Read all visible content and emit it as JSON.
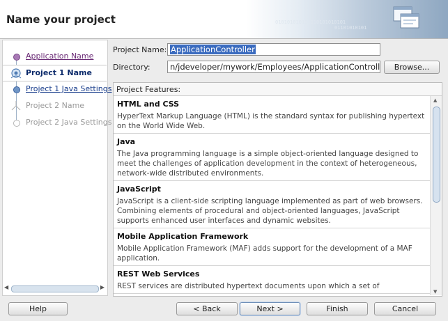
{
  "header": {
    "title": "Name your project"
  },
  "nav": {
    "items": [
      {
        "label": "Application Name",
        "state": "visited"
      },
      {
        "label": "Project 1 Name",
        "state": "active"
      },
      {
        "label": "Project 1 Java Settings",
        "state": "link"
      },
      {
        "label": "Project 2 Name",
        "state": "disabled"
      },
      {
        "label": "Project 2 Java Settings",
        "state": "disabled"
      }
    ]
  },
  "form": {
    "project_name_label": "Project Name:",
    "project_name_value": "ApplicationController",
    "directory_label": "Directory:",
    "directory_value": "n/jdeveloper/mywork/Employees/ApplicationController",
    "browse_label": "Browse..."
  },
  "features": {
    "header": "Project Features:",
    "items": [
      {
        "title": "HTML and CSS",
        "desc": "HyperText Markup Language (HTML) is the standard syntax for publishing hypertext on the World Wide Web."
      },
      {
        "title": "Java",
        "desc": "The Java programming language is a simple object-oriented language designed to meet the challenges of application development in the context of heterogeneous, network-wide distributed environments."
      },
      {
        "title": "JavaScript",
        "desc": "JavaScript is a client-side scripting language implemented as part of web browsers. Combining elements of procedural and object-oriented languages, JavaScript supports enhanced user interfaces and dynamic websites."
      },
      {
        "title": "Mobile Application Framework",
        "desc": "Mobile Application Framework (MAF) adds support for the development of a MAF application."
      },
      {
        "title": "REST Web Services",
        "desc": "REST services are distributed hypertext documents upon which a set of"
      }
    ]
  },
  "buttons": {
    "help": "Help",
    "back": "< Back",
    "next": "Next >",
    "finish": "Finish",
    "cancel": "Cancel"
  },
  "decor": {
    "binary1": "010101010101010101010101",
    "binary2": "01101010101"
  },
  "colors": {
    "selection": "#3a6bbf",
    "active_nav": "#0d2b6b",
    "visited_link": "#6a2a75",
    "link": "#1a3e8c"
  }
}
